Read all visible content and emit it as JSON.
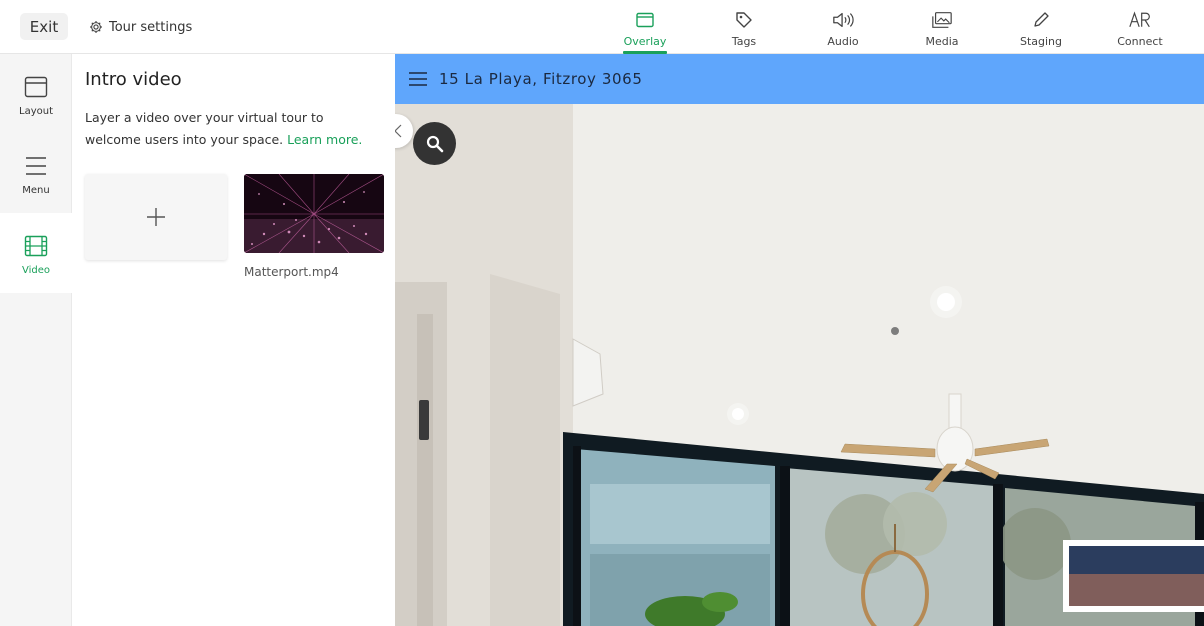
{
  "topbar": {
    "exit_label": "Exit",
    "tour_settings_label": "Tour settings",
    "nav": [
      {
        "label": "Overlay",
        "icon": "overlay-icon",
        "active": true
      },
      {
        "label": "Tags",
        "icon": "tag-icon",
        "active": false
      },
      {
        "label": "Audio",
        "icon": "speaker-icon",
        "active": false
      },
      {
        "label": "Media",
        "icon": "images-icon",
        "active": false
      },
      {
        "label": "Staging",
        "icon": "pencil-icon",
        "active": false
      },
      {
        "label": "Connect",
        "icon": "ar-icon",
        "active": false
      }
    ]
  },
  "rail": {
    "items": [
      {
        "label": "Layout",
        "icon": "layout-icon",
        "active": false
      },
      {
        "label": "Menu",
        "icon": "menu-icon",
        "active": false
      },
      {
        "label": "Video",
        "icon": "film-icon",
        "active": true
      }
    ]
  },
  "panel": {
    "title": "Intro video",
    "description": "Layer a video over your virtual tour to welcome users into your space.",
    "learn_more": "Learn more.",
    "videos": [
      {
        "name": "Matterport.mp4"
      }
    ]
  },
  "viewer": {
    "title": "15 La Playa, Fitzroy 3065"
  },
  "colors": {
    "accent": "#1aa05a",
    "viewer_header": "#5fa6fc",
    "rail_bg": "#f5f5f5"
  }
}
